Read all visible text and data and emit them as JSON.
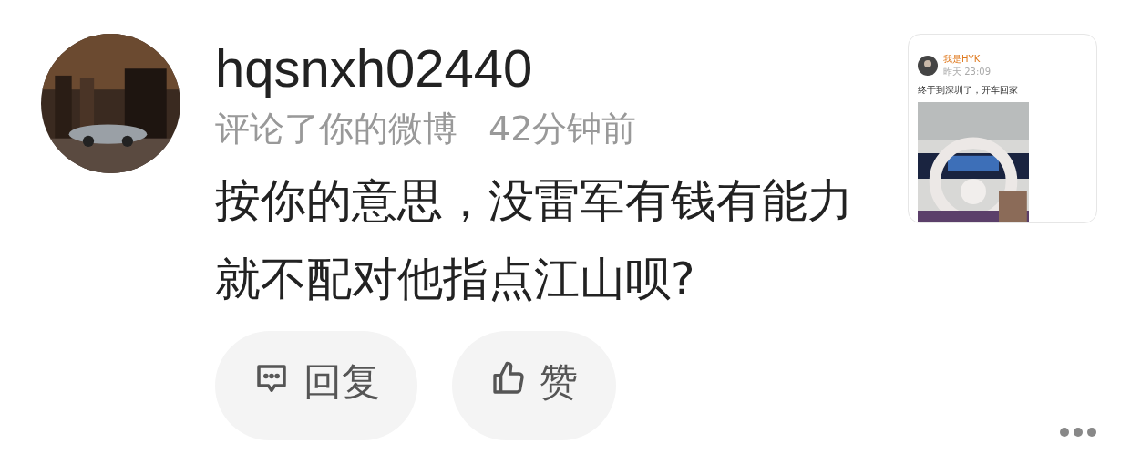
{
  "comment": {
    "username": "hqsnxh02440",
    "action": "评论了你的微博",
    "time": "42分钟前",
    "text": "按你的意思，没雷军有钱有能力就不配对他指点江山呗?"
  },
  "post_preview": {
    "author": "我是HYK",
    "time": "昨天 23:09",
    "text": "终于到深圳了，开车回家"
  },
  "actions": [
    {
      "kind": "reply",
      "label": "回复"
    },
    {
      "kind": "like",
      "label": "赞"
    }
  ]
}
